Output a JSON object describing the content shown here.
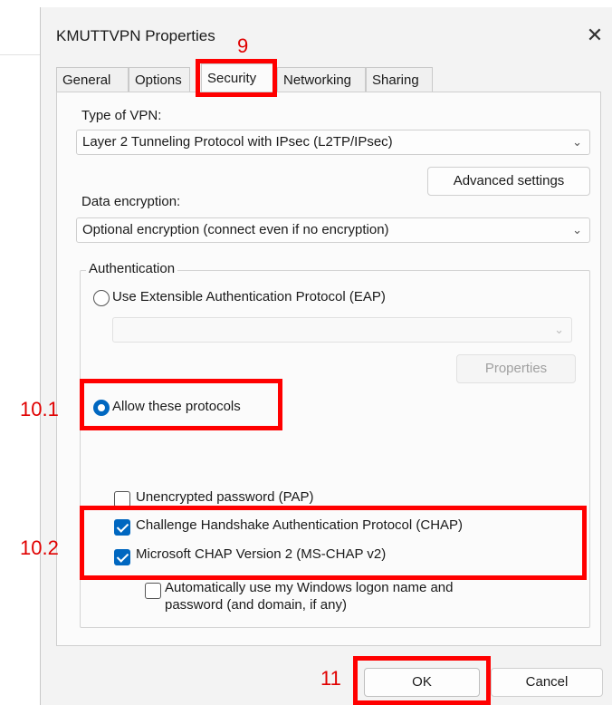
{
  "dialog": {
    "title": "KMUTTVPN Properties",
    "close_glyph": "✕"
  },
  "tabs": [
    {
      "label": "General"
    },
    {
      "label": "Options"
    },
    {
      "label": "Security"
    },
    {
      "label": "Networking"
    },
    {
      "label": "Sharing"
    }
  ],
  "active_tab": "Security",
  "security": {
    "vpn_type_label": "Type of VPN:",
    "vpn_type_value": "Layer 2 Tunneling Protocol with IPsec (L2TP/IPsec)",
    "advanced_settings": "Advanced settings",
    "data_encryption_label": "Data encryption:",
    "data_encryption_value": "Optional encryption (connect even if no encryption)",
    "authentication_group": "Authentication",
    "eap_option": "Use Extensible Authentication Protocol (EAP)",
    "eap_select_value": "",
    "eap_properties": "Properties",
    "allow_protocols_option": "Allow these protocols",
    "pap": "Unencrypted password (PAP)",
    "chap": "Challenge Handshake Authentication Protocol (CHAP)",
    "mschapv2": "Microsoft CHAP Version 2 (MS-CHAP v2)",
    "auto_logon_line1": "Automatically use my Windows logon name and",
    "auto_logon_line2": "password (and domain, if any)"
  },
  "states": {
    "eap_selected": false,
    "allow_protocols_selected": true,
    "pap_checked": false,
    "chap_checked": true,
    "mschapv2_checked": true,
    "auto_logon_checked": false
  },
  "buttons": {
    "ok": "OK",
    "cancel": "Cancel"
  },
  "annotations": {
    "step_9": "9",
    "step_10_1": "10.1",
    "step_10_2": "10.2",
    "step_11": "11"
  },
  "colors": {
    "accent": "#0067c0",
    "annotation_red": "#ff0000"
  },
  "icons": {
    "dropdown": "chevron-down-icon",
    "close": "close-icon"
  }
}
